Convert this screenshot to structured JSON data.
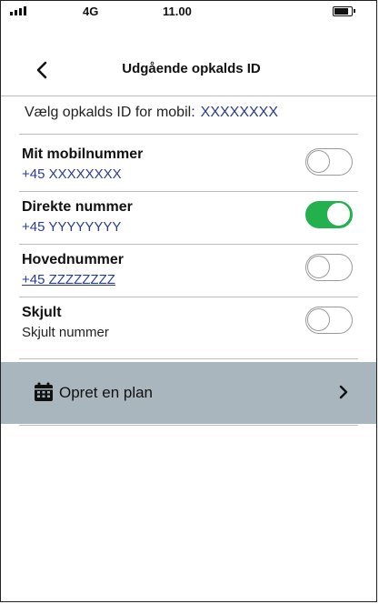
{
  "status_bar": {
    "network": "4G",
    "time": "11.00"
  },
  "header": {
    "title": "Udgående opkalds ID"
  },
  "caller_id": {
    "label": "Vælg opkalds ID for mobil:",
    "value": "XXXXXXXX"
  },
  "options": [
    {
      "title": "Mit mobilnummer",
      "number": "+45  XXXXXXXX",
      "enabled": false
    },
    {
      "title": "Direkte nummer",
      "number": "+45  YYYYYYYY",
      "enabled": true
    },
    {
      "title": "Hovednummer",
      "number": "+45  ZZZZZZZZ",
      "enabled": false
    },
    {
      "title": "Skjult",
      "number": "Skjult nummer",
      "enabled": false
    }
  ],
  "plan": {
    "label": "Opret en plan",
    "icon": "calendar-icon"
  },
  "colors": {
    "toggle_on": "#22b14c",
    "plan_background": "#a9b6bd",
    "number_text": "#2a3d8f"
  }
}
